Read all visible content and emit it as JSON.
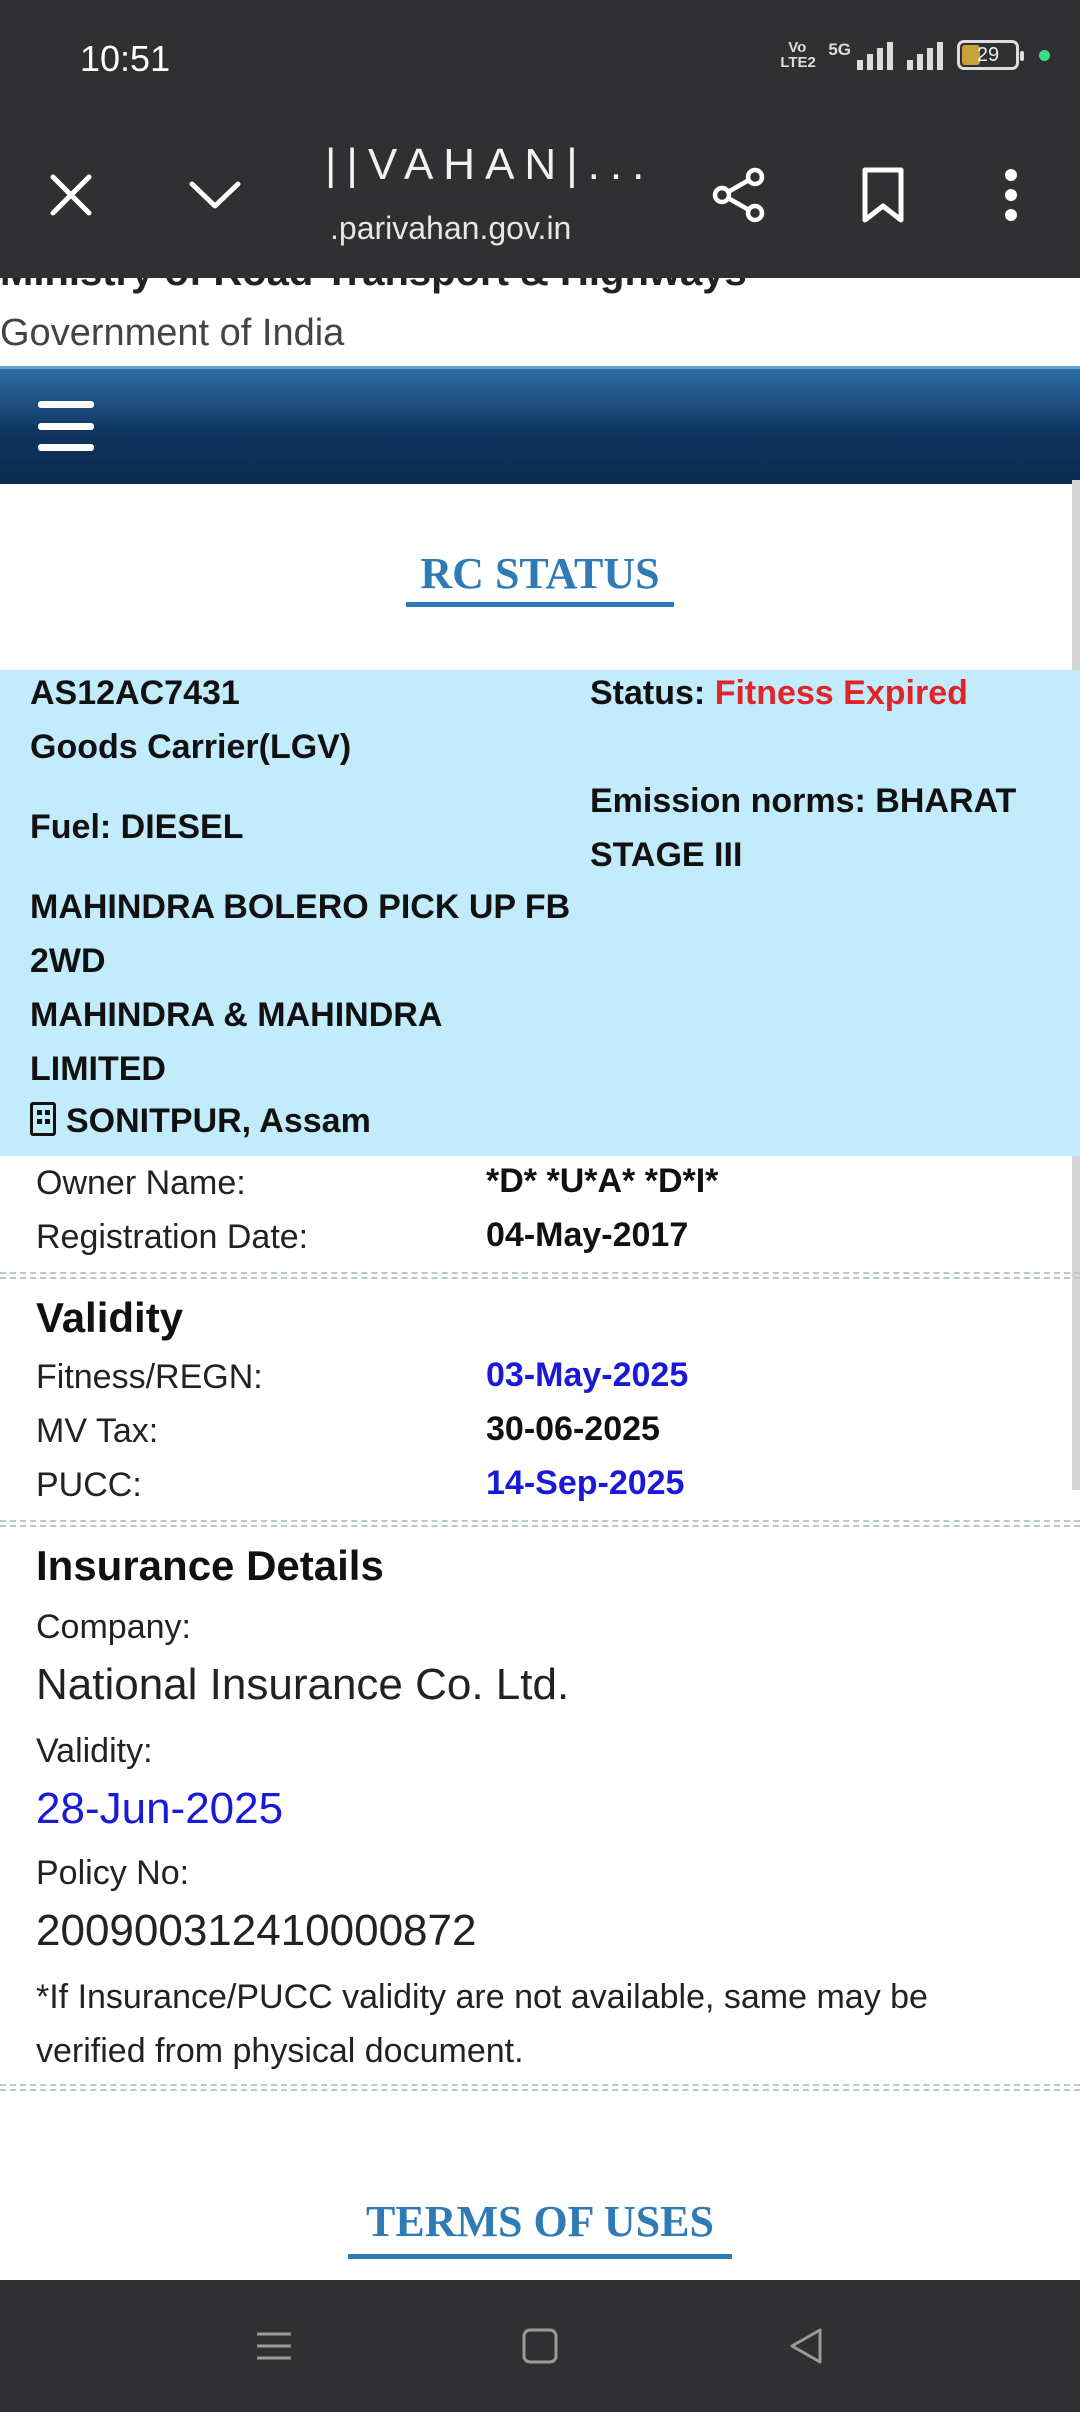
{
  "status_bar": {
    "time": "10:51",
    "volte": "Vo LTE2",
    "network": "5G",
    "battery": "29"
  },
  "browser": {
    "title": "||VAHAN|...",
    "url": ".parivahan.gov.in"
  },
  "site": {
    "ministry": "Ministry of Road Transport & Highways",
    "government": "Government of India",
    "heading": "RC STATUS",
    "terms": "TERMS OF USES"
  },
  "vehicle": {
    "reg_no": "AS12AC7431",
    "vehicle_class": "Goods Carrier(LGV)",
    "fuel": "Fuel: DIESEL",
    "model_line1": "MAHINDRA BOLERO PICK UP FB",
    "model_line2": "2WD",
    "maker_line1": "MAHINDRA & MAHINDRA",
    "maker_line2": "LIMITED",
    "location": "SONITPUR, Assam",
    "status_label": "Status:",
    "status_value": "Fitness Expired",
    "emission_line1": "Emission norms: BHARAT",
    "emission_line2": "STAGE III"
  },
  "owner": {
    "owner_label": "Owner Name:",
    "owner_value": "*D* *U*A* *D*I*",
    "reg_date_label": "Registration Date:",
    "reg_date_value": "04-May-2017"
  },
  "validity": {
    "title": "Validity",
    "fitness_label": "Fitness/REGN:",
    "fitness_value": "03-May-2025",
    "tax_label": "MV Tax:",
    "tax_value": "30-06-2025",
    "pucc_label": "PUCC:",
    "pucc_value": "14-Sep-2025"
  },
  "insurance": {
    "title": "Insurance Details",
    "company_label": "Company:",
    "company_value": "National Insurance Co. Ltd.",
    "validity_label": "Validity:",
    "validity_value": "28-Jun-2025",
    "policy_label": "Policy No:",
    "policy_value": "200900312410000872",
    "note": "*If Insurance/PUCC validity are not available, same may be verified from physical document."
  },
  "colors": {
    "status_expired": "#e2242a",
    "link_blue": "#1a1ad6",
    "heading_blue": "#2f7bb6",
    "panel_bg": "#c2ecfb"
  }
}
